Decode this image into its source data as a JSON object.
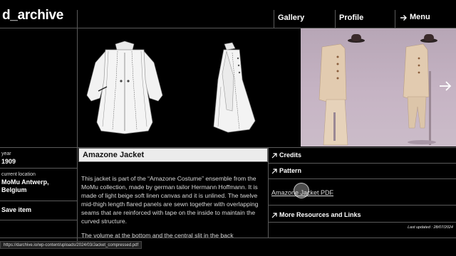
{
  "header": {
    "logo": "d_archive",
    "nav": [
      {
        "label": "Gallery"
      },
      {
        "label": "Profile"
      },
      {
        "label": "Menu"
      }
    ]
  },
  "item": {
    "year_label": "year",
    "year": "1909",
    "location_label": "current location",
    "location": "MoMu Antwerp, Belgium",
    "save_label": "Save item",
    "title": "Amazone Jacket",
    "description": "This jacket is part of the “Amazone Costume” ensemble from the MoMu collection, made by german tailor Hermann Hoffmann. It is made of light beige soft linen canvas and it is unlined. The twelve mid-thigh length flared panels are sewn together with overlapping seams that are reinforced with tape on the inside to maintain the curved structure.",
    "description_more": "The volume at the bottom and the central slit in the back"
  },
  "links": {
    "credits": "Credits",
    "pattern": "Pattern",
    "pdf": "Amazone Jacket PDF",
    "resources": "More Resources and Links",
    "updated": "Last updated : 28/07/2024"
  },
  "status": {
    "url": "https://darchive.io/wp-content/uploads/2024/03/Jacket_compressed.pdf"
  },
  "colors": {
    "background": "#000000",
    "title_bar": "#ececec",
    "photo_bg": "#c2b0c0",
    "garment_white": "#f2f2f2",
    "linen": "#e2cbb0"
  },
  "icons": [
    "arrow-up-right-icon",
    "arrow-right-icon",
    "chevron-right-icon"
  ]
}
